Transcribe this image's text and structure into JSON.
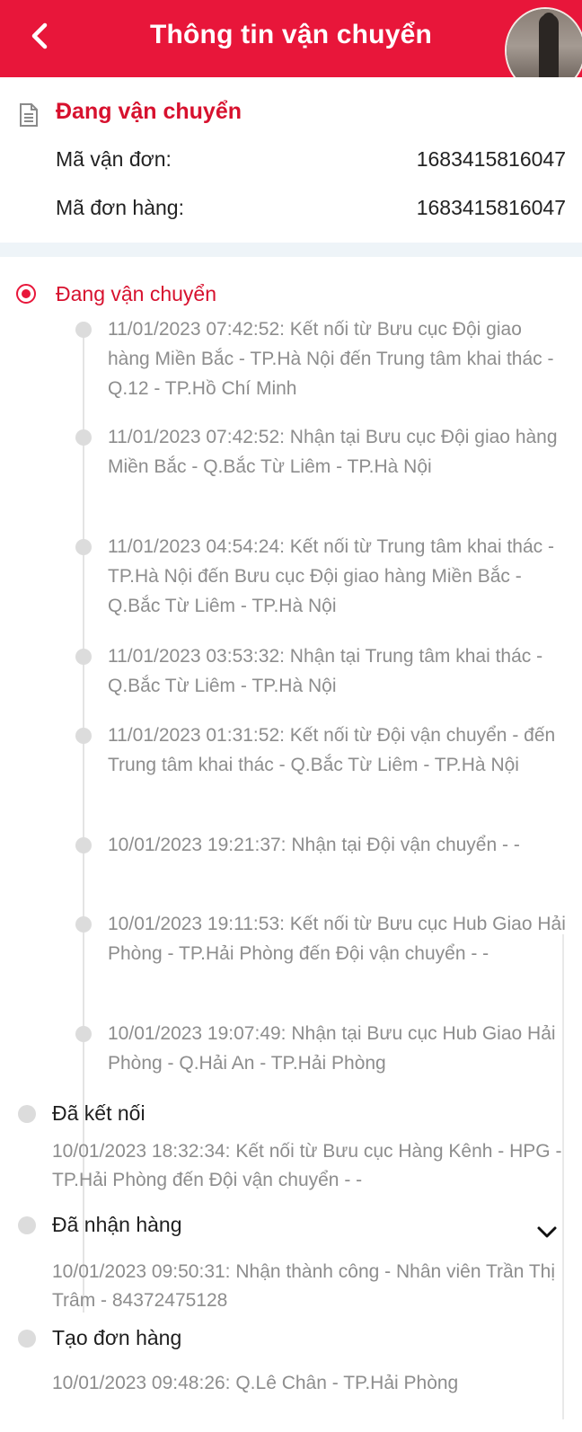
{
  "header": {
    "title": "Thông tin vận chuyển",
    "bg_color": "#e8163a",
    "back_icon": "chevron-left-icon"
  },
  "info": {
    "status": "Đang vận chuyển",
    "doc_icon": "document-icon",
    "rows": [
      {
        "label": "Mã vận đơn:",
        "value": "1683415816047"
      },
      {
        "label": "Mã đơn hàng:",
        "value": "1683415816047"
      }
    ]
  },
  "timeline": {
    "active": {
      "title": "Đang vận chuyển",
      "items": [
        "11/01/2023 07:42:52: Kết nối từ Bưu cục Đội giao hàng Miền Bắc - TP.Hà Nội đến Trung tâm khai thác - Q.12 - TP.Hồ Chí Minh",
        "11/01/2023 07:42:52: Nhận tại Bưu cục Đội giao hàng Miền Bắc - Q.Bắc Từ Liêm - TP.Hà Nội",
        "11/01/2023 04:54:24: Kết nối từ Trung tâm khai thác - TP.Hà Nội đến Bưu cục Đội giao hàng Miền Bắc - Q.Bắc Từ Liêm - TP.Hà Nội",
        "11/01/2023 03:53:32: Nhận tại Trung tâm khai thác - Q.Bắc Từ Liêm - TP.Hà Nội",
        "11/01/2023 01:31:52: Kết nối từ Đội vận chuyển -  đến Trung tâm khai thác - Q.Bắc Từ Liêm - TP.Hà Nội",
        "10/01/2023 19:21:37: Nhận tại Đội vận chuyển -  -",
        "10/01/2023 19:11:53: Kết nối từ Bưu cục Hub Giao Hải Phòng - TP.Hải Phòng đến Đội vận chuyển -  -",
        "10/01/2023 19:07:49: Nhận tại Bưu cục Hub Giao Hải Phòng - Q.Hải An - TP.Hải Phòng"
      ]
    },
    "groups": [
      {
        "title": "Đã kết nối",
        "desc": "10/01/2023 18:32:34: Kết nối từ Bưu cục Hàng Kênh - HPG - TP.Hải Phòng đến Đội vận chuyển -  -"
      },
      {
        "title": "Đã nhận hàng",
        "desc": "10/01/2023 09:50:31: Nhận thành công - Nhân viên Trần Thị Trâm - 84372475128",
        "expand_icon": "chevron-down-icon"
      },
      {
        "title": "Tạo đơn hàng",
        "desc": "10/01/2023 09:48:26: Q.Lê Chân - TP.Hải Phòng"
      }
    ]
  }
}
